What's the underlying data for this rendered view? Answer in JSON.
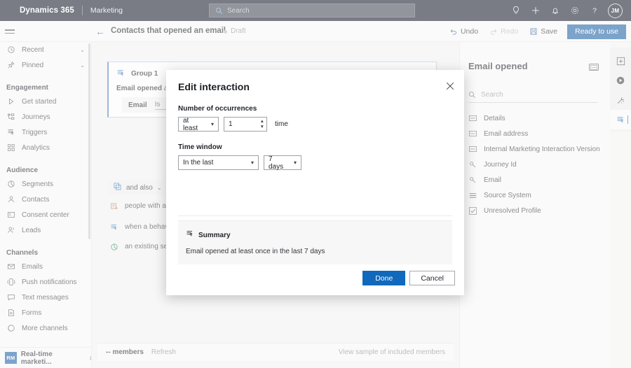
{
  "topnav": {
    "brand": "Dynamics 365",
    "app": "Marketing",
    "search_placeholder": "Search",
    "icons": [
      "lightbulb-icon",
      "plus-icon",
      "bell-icon",
      "gear-icon",
      "help-icon"
    ],
    "avatar_initials": "JM"
  },
  "commandbar": {
    "back_label": "←",
    "page_title": "Contacts that opened an email",
    "status": "Draft",
    "undo": "Undo",
    "redo": "Redo",
    "save": "Save",
    "primary": "Ready to use"
  },
  "sidebar": {
    "quick": [
      {
        "label": "Recent",
        "icon": "clock-icon",
        "chevron": "⌄"
      },
      {
        "label": "Pinned",
        "icon": "pin-icon",
        "chevron": "⌄"
      }
    ],
    "groups": [
      {
        "title": "Engagement",
        "items": [
          {
            "label": "Get started",
            "icon": "play-icon"
          },
          {
            "label": "Journeys",
            "icon": "journeys-icon"
          },
          {
            "label": "Triggers",
            "icon": "triggers-icon"
          },
          {
            "label": "Analytics",
            "icon": "analytics-icon"
          }
        ]
      },
      {
        "title": "Audience",
        "items": [
          {
            "label": "Segments",
            "icon": "segments-icon"
          },
          {
            "label": "Contacts",
            "icon": "person-icon"
          },
          {
            "label": "Consent center",
            "icon": "consent-icon"
          },
          {
            "label": "Leads",
            "icon": "leads-icon"
          }
        ]
      },
      {
        "title": "Channels",
        "items": [
          {
            "label": "Emails",
            "icon": "mail-icon"
          },
          {
            "label": "Push notifications",
            "icon": "push-icon"
          },
          {
            "label": "Text messages",
            "icon": "sms-icon"
          },
          {
            "label": "Forms",
            "icon": "forms-icon"
          },
          {
            "label": "More channels",
            "icon": "more-channels-icon"
          }
        ]
      }
    ],
    "footer": {
      "badge": "RM",
      "label": "Real-time marketi..."
    }
  },
  "canvas": {
    "group": {
      "title": "Group 1",
      "icon": "triggers-icon",
      "condition_subject": "Email opened",
      "condition_qualifier": "at le",
      "attribute_key": "Email",
      "attribute_operator": "Is",
      "attribute_value": ""
    },
    "and_also": {
      "label": "and also",
      "chevron": "⌄",
      "icon": "copy-icon"
    },
    "options": [
      {
        "label": "people with a sp",
        "icon": "attribute-icon",
        "color": "#c4634a"
      },
      {
        "label": "when a behavio",
        "icon": "triggers-icon",
        "color": "#2f6fb5"
      },
      {
        "label": "an existing segm",
        "icon": "segments-icon",
        "color": "#1f8a4c"
      }
    ],
    "bottombar": {
      "count": "-- members",
      "refresh": "Refresh",
      "view_sample": "View sample of included members"
    }
  },
  "rightpanel": {
    "title": "Email opened",
    "chip_icon": "attribute-chip-icon",
    "search_placeholder": "Search",
    "items": [
      {
        "label": "Details",
        "icon": "attribute-icon"
      },
      {
        "label": "Email address",
        "icon": "attribute-icon"
      },
      {
        "label": "Internal Marketing Interaction Version",
        "icon": "attribute-icon"
      },
      {
        "label": "Journey Id",
        "icon": "key-icon"
      },
      {
        "label": "Email",
        "icon": "key-icon"
      },
      {
        "label": "Source System",
        "icon": "list-icon"
      },
      {
        "label": "Unresolved Profile",
        "icon": "checkbox-icon"
      }
    ]
  },
  "rail": {
    "buttons": [
      {
        "name": "add-panel-icon",
        "active": false
      },
      {
        "name": "play-circle-icon",
        "active": false
      },
      {
        "name": "magic-wand-icon",
        "active": false
      },
      {
        "name": "triggers-icon",
        "active": true
      }
    ]
  },
  "dialog": {
    "title": "Edit interaction",
    "close_icon": "close-icon",
    "occurrences": {
      "label": "Number of occurrences",
      "comparator": "at least",
      "count": "1",
      "unit": "time"
    },
    "time_window": {
      "label": "Time window",
      "mode": "In the last",
      "duration": "7 days"
    },
    "summary": {
      "icon": "triggers-icon",
      "title": "Summary",
      "text": "Email opened at least once in the last 7 days"
    },
    "done": "Done",
    "cancel": "Cancel"
  },
  "colors": {
    "brand_dark": "#0b1021",
    "accent_blue": "#1069bc",
    "primary_button": "#12589e",
    "surface": "#f6f6f6",
    "canvas": "#f0f0f0"
  }
}
